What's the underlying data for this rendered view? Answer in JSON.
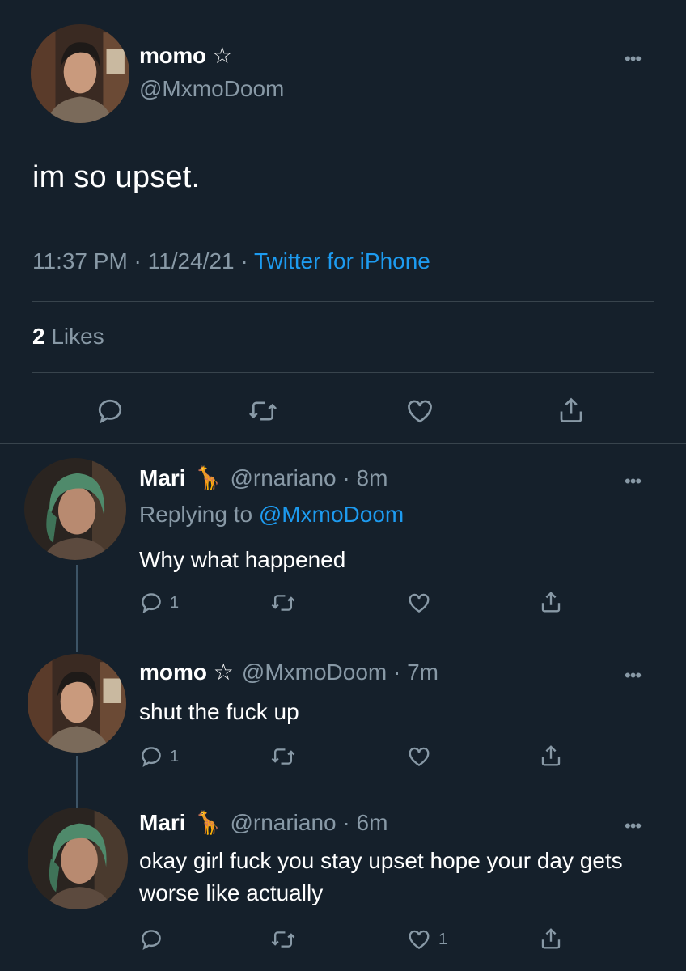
{
  "main_tweet": {
    "author_name": "momo ☆",
    "author_handle": "@MxmoDoom",
    "text": "im so upset.",
    "time": "11:37 PM",
    "date": "11/24/21",
    "source": "Twitter for iPhone",
    "likes_count": "2",
    "likes_label": "Likes"
  },
  "replies": [
    {
      "author_name": "Mari",
      "emoji": "🦒",
      "handle_time": "@rnariano · 8m",
      "replying_prefix": "Replying to",
      "replying_to": "@MxmoDoom",
      "text": "Why what happened",
      "reply_count": "1",
      "like_count": ""
    },
    {
      "author_name": "momo ☆",
      "handle_time": "@MxmoDoom · 7m",
      "text": "shut the fuck up",
      "reply_count": "1",
      "like_count": ""
    },
    {
      "author_name": "Mari",
      "emoji": "🦒",
      "handle_time": "@rnariano · 6m",
      "text": "okay girl fuck you stay upset hope your day gets worse like actually",
      "reply_count": "",
      "like_count": "1"
    }
  ],
  "ui": {
    "more_glyph": "•••",
    "meta_sep": " · "
  },
  "colors": {
    "background": "#15202b",
    "muted": "#8899a6",
    "link": "#1d9bf0",
    "divider": "#38444d"
  },
  "icons": [
    "reply-icon",
    "retweet-icon",
    "like-icon",
    "share-icon",
    "more-icon"
  ]
}
